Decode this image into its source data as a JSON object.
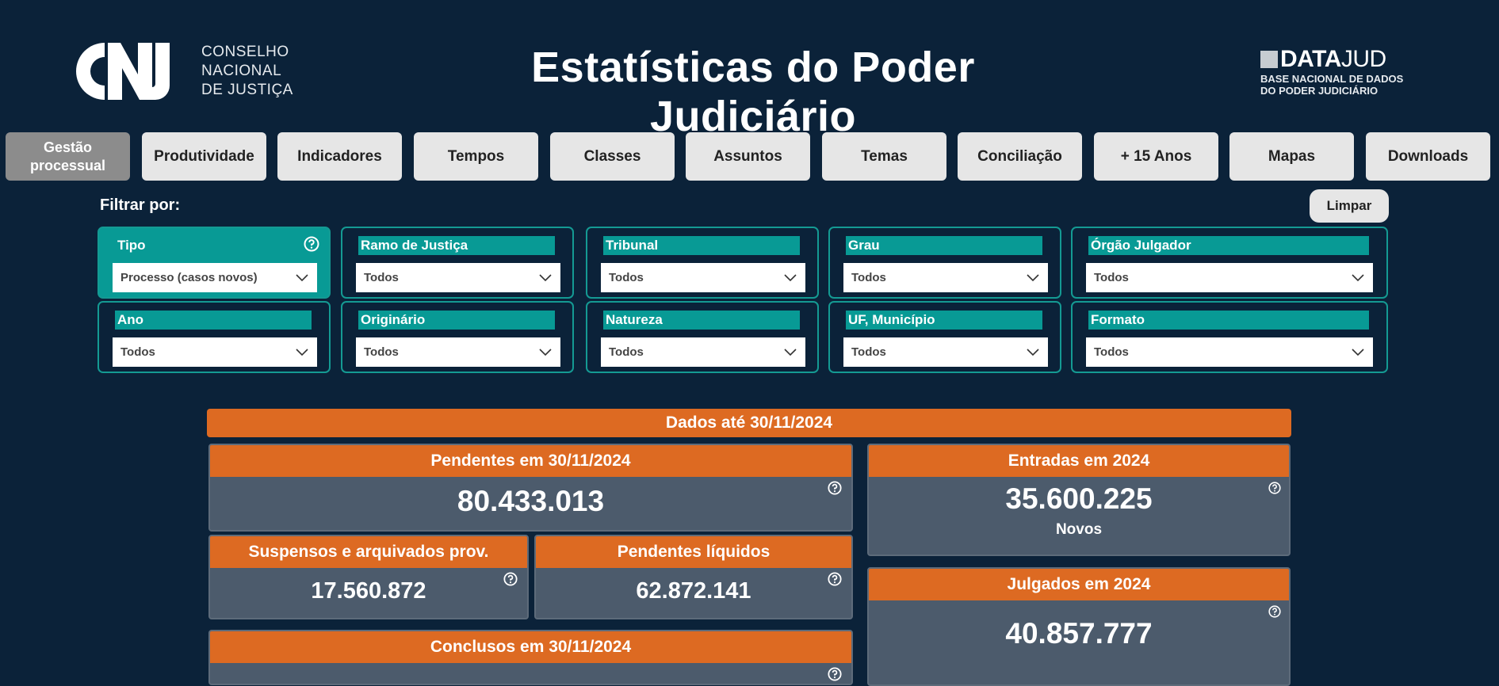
{
  "header": {
    "org_logo_text": [
      "CONSELHO",
      "NACIONAL",
      "DE JUSTIÇA"
    ],
    "title": "Estatísticas do Poder Judiciário",
    "datajud": {
      "brand_bold": "DATA",
      "brand_light": "JUD",
      "sub_line1": "BASE NACIONAL DE DADOS",
      "sub_line2": "DO PODER JUDICIÁRIO"
    }
  },
  "nav": [
    {
      "label": "Gestão processual",
      "active": true
    },
    {
      "label": "Produtividade"
    },
    {
      "label": "Indicadores"
    },
    {
      "label": "Tempos"
    },
    {
      "label": "Classes"
    },
    {
      "label": "Assuntos"
    },
    {
      "label": "Temas"
    },
    {
      "label": "Conciliação"
    },
    {
      "label": "+ 15 Anos"
    },
    {
      "label": "Mapas"
    },
    {
      "label": "Downloads"
    }
  ],
  "filters": {
    "label": "Filtrar por:",
    "clear_label": "Limpar",
    "items": [
      {
        "label": "Tipo",
        "value": "Processo (casos novos)"
      },
      {
        "label": "Ramo de Justiça",
        "value": "Todos"
      },
      {
        "label": "Tribunal",
        "value": "Todos"
      },
      {
        "label": "Grau",
        "value": "Todos"
      },
      {
        "label": "Órgão Julgador",
        "value": "Todos"
      },
      {
        "label": "Ano",
        "value": "Todos"
      },
      {
        "label": "Originário",
        "value": "Todos"
      },
      {
        "label": "Natureza",
        "value": "Todos"
      },
      {
        "label": "UF, Município",
        "value": "Todos"
      },
      {
        "label": "Formato",
        "value": "Todos"
      }
    ]
  },
  "data_banner": "Dados até 30/11/2024",
  "cards": {
    "pendentes": {
      "title": "Pendentes em 30/11/2024",
      "value": "80.433.013"
    },
    "suspensos": {
      "title": "Suspensos e arquivados prov.",
      "value": "17.560.872"
    },
    "liquidos": {
      "title": "Pendentes líquidos",
      "value": "62.872.141"
    },
    "conclusos": {
      "title": "Conclusos em 30/11/2024"
    },
    "entradas": {
      "title": "Entradas em 2024",
      "value": "35.600.225",
      "sub": "Novos"
    },
    "julgados": {
      "title": "Julgados em 2024",
      "value": "40.857.777"
    }
  },
  "colors": {
    "background": "#0b2239",
    "accent_orange": "#dd6a22",
    "accent_teal": "#089a95",
    "card_body": "#4c5b6c"
  }
}
